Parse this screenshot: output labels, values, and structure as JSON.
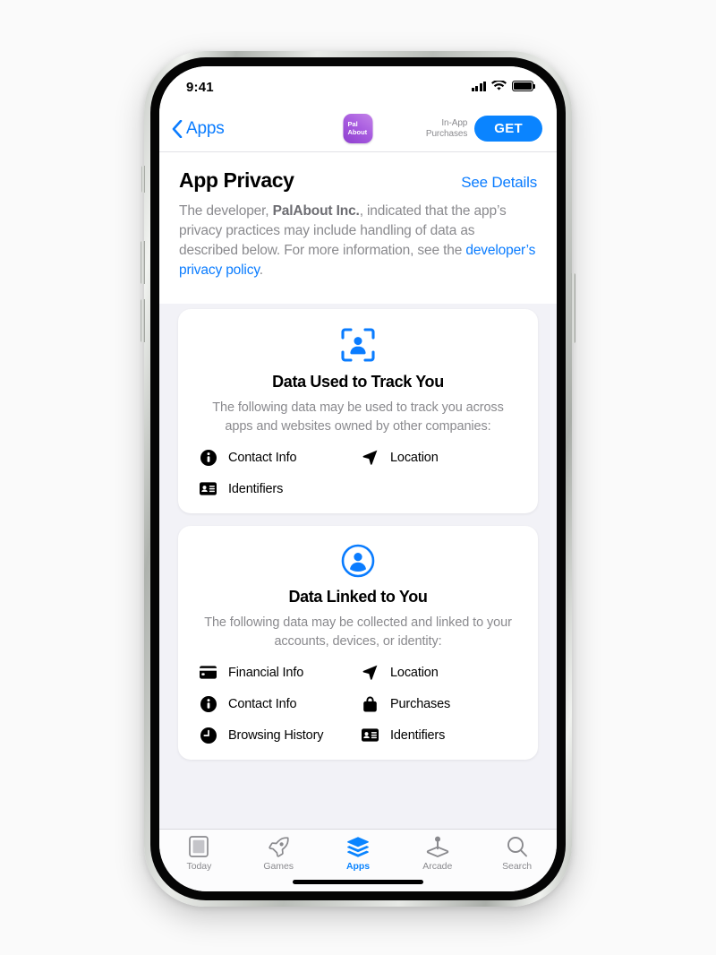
{
  "statusbar": {
    "time": "9:41",
    "signal_icon": "signal-bars-icon",
    "wifi_icon": "wifi-icon",
    "battery_icon": "battery-icon"
  },
  "navbar": {
    "back_label": "Apps",
    "back_icon": "chevron-left-icon",
    "app_icon_line1": "Pal",
    "app_icon_line2": "About",
    "in_app_purchases_line1": "In-App",
    "in_app_purchases_line2": "Purchases",
    "get_label": "GET",
    "get_color": "#0a84ff"
  },
  "privacy": {
    "title": "App Privacy",
    "see_details": "See Details",
    "description_part1": "The developer, ",
    "description_developer": "PalAbout Inc.",
    "description_part2": ", indicated that the app’s privacy practices may include handling of data as described below. For more information, see the ",
    "description_link": "developer’s privacy policy",
    "description_part3": "."
  },
  "cards": [
    {
      "icon": "person-in-viewfinder-icon",
      "title": "Data Used to Track You",
      "subtitle": "The following data may be used to track you across apps and websites owned by other companies:",
      "items": [
        {
          "icon": "info-circle-icon",
          "label": "Contact Info"
        },
        {
          "icon": "location-arrow-icon",
          "label": "Location"
        },
        {
          "icon": "id-card-icon",
          "label": "Identifiers"
        }
      ]
    },
    {
      "icon": "person-circle-icon",
      "title": "Data Linked to You",
      "subtitle": "The following data may be collected and linked to your accounts, devices, or identity:",
      "items": [
        {
          "icon": "credit-card-icon",
          "label": "Financial Info"
        },
        {
          "icon": "location-arrow-icon",
          "label": "Location"
        },
        {
          "icon": "info-circle-icon",
          "label": "Contact Info"
        },
        {
          "icon": "shopping-bag-icon",
          "label": "Purchases"
        },
        {
          "icon": "clock-icon",
          "label": "Browsing History"
        },
        {
          "icon": "id-card-icon",
          "label": "Identifiers"
        }
      ]
    }
  ],
  "tabbar": {
    "active": "Apps",
    "accent_color": "#0a84ff",
    "inactive_color": "#8a8a8e",
    "items": [
      {
        "icon": "today-document-icon",
        "label": "Today"
      },
      {
        "icon": "rocket-icon",
        "label": "Games"
      },
      {
        "icon": "layers-icon",
        "label": "Apps"
      },
      {
        "icon": "joystick-icon",
        "label": "Arcade"
      },
      {
        "icon": "search-icon",
        "label": "Search"
      }
    ]
  }
}
